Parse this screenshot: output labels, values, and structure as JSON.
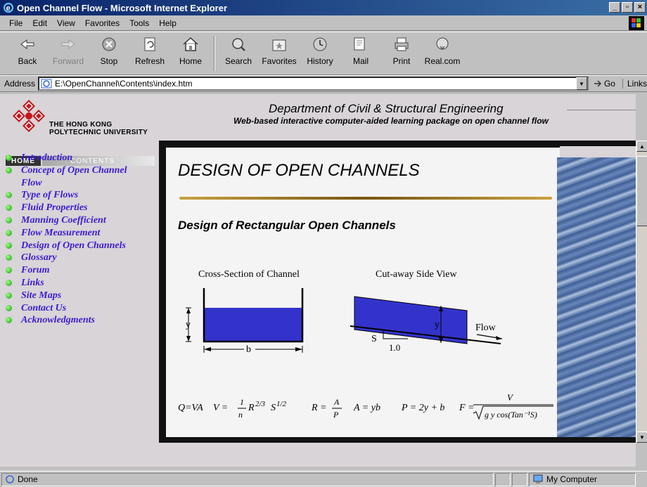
{
  "window": {
    "title": "Open Channel Flow - Microsoft Internet Explorer",
    "buttons": [
      "_",
      "▫",
      "×"
    ]
  },
  "menu": [
    "File",
    "Edit",
    "View",
    "Favorites",
    "Tools",
    "Help"
  ],
  "toolbar": [
    {
      "label": "Back",
      "icon": "back-arrow-icon",
      "enabled": true
    },
    {
      "label": "Forward",
      "icon": "forward-arrow-icon",
      "enabled": false
    },
    {
      "label": "Stop",
      "icon": "stop-icon",
      "enabled": true
    },
    {
      "label": "Refresh",
      "icon": "refresh-icon",
      "enabled": true
    },
    {
      "label": "Home",
      "icon": "home-icon",
      "enabled": true
    },
    {
      "label": "Search",
      "icon": "search-icon",
      "enabled": true
    },
    {
      "label": "Favorites",
      "icon": "favorites-icon",
      "enabled": true
    },
    {
      "label": "History",
      "icon": "history-icon",
      "enabled": true
    },
    {
      "label": "Mail",
      "icon": "mail-icon",
      "enabled": true
    },
    {
      "label": "Print",
      "icon": "print-icon",
      "enabled": true
    },
    {
      "label": "Real.com",
      "icon": "real-icon",
      "enabled": true
    }
  ],
  "address": {
    "label": "Address",
    "value": "E:\\OpenChannel\\Contents\\index.htm",
    "go": "Go",
    "links": "Links"
  },
  "header": {
    "university": "THE HONG KONG",
    "university2": "POLYTECHNIC UNIVERSITY",
    "department": "Department of Civil & Structural Engineering",
    "subtitle": "Web-based interactive computer-aided learning package on open channel flow"
  },
  "nav_tabs": {
    "home": "HOME",
    "contents": "CONTENTS"
  },
  "nav": [
    "Introduction",
    "Concept of Open Channel Flow",
    "Type of Flows",
    "Fluid Properties",
    "Manning Coefficient",
    "Flow Measurement",
    "Design of Open Channels",
    "Glossary",
    "Forum",
    "Links",
    "Site Maps",
    "Contact Us",
    "Acknowledgments"
  ],
  "main": {
    "title": "DESIGN OF OPEN CHANNELS",
    "section": "Design of Rectangular Open Channels",
    "caption_cross": "Cross-Section of Channel",
    "caption_side": "Cut-away Side View",
    "label_y": "y",
    "label_b": "b",
    "label_s": "S",
    "label_run": "1.0",
    "label_flow": "Flow",
    "formula": {
      "q": "Q=VA",
      "v_lhs": "V =",
      "v_num": "1",
      "v_den": "n",
      "v_rest": "R",
      "v_exp": "2/3",
      "v_s": "S",
      "v_sexp": "1/2",
      "r_lhs": "R =",
      "r_num": "A",
      "r_den": "P",
      "a": "A = yb",
      "p": "P = 2y + b",
      "f_lhs": "F =",
      "f_num": "V",
      "f_den": "g y cos(Tan⁻¹S)"
    },
    "water_color": "#2b4e8a",
    "channel_color": "#3333cc"
  },
  "status": {
    "text": "Done",
    "zone": "My Computer"
  }
}
